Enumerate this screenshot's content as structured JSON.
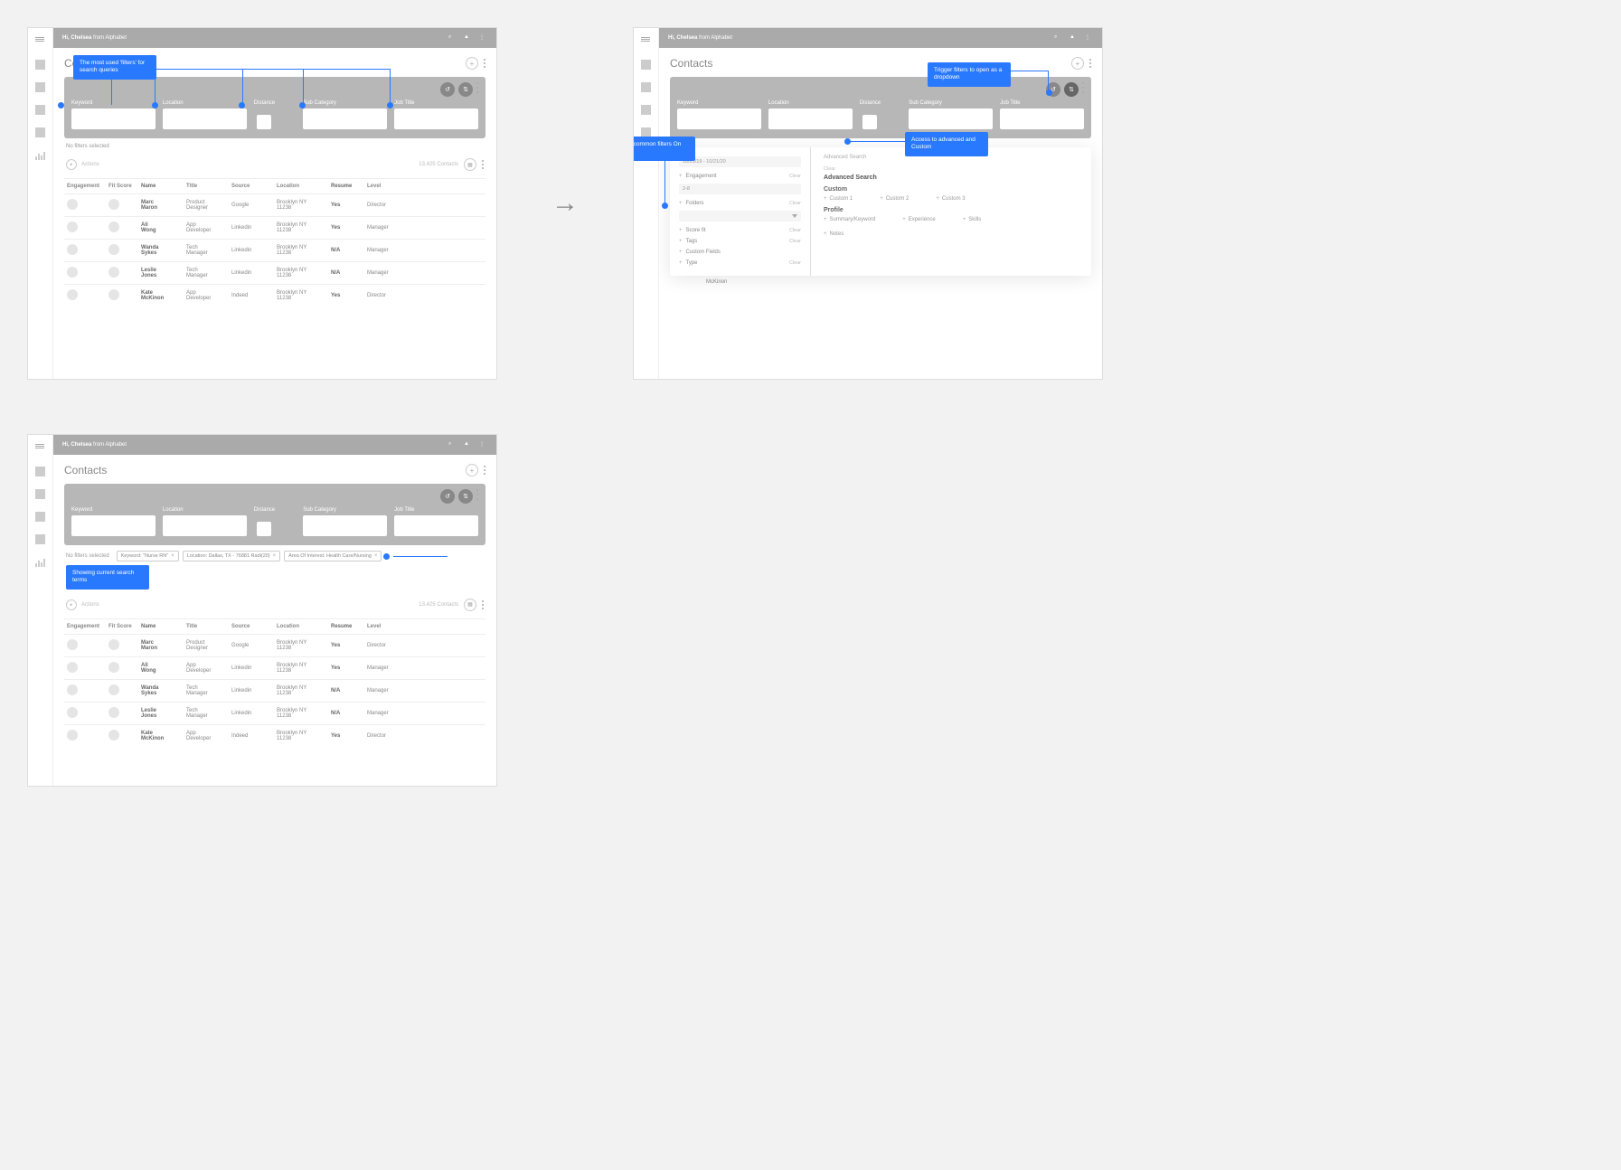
{
  "topbar": {
    "hi": "Hi, Chelsea",
    "from": "from Alphabet"
  },
  "page": {
    "title": "Contacts"
  },
  "filters": {
    "keyword": "Keyword",
    "location": "Location",
    "distance": "Distance",
    "subcat": "Sub Category",
    "jobtitle": "Job Title"
  },
  "noFilters": "No filters selected",
  "toolbar": {
    "actions": "Actions",
    "count": "13,425 Contacts"
  },
  "columns": [
    "Engagement",
    "Fit Score",
    "Name",
    "Title",
    "Source",
    "Location",
    "Resume",
    "Level"
  ],
  "rows": [
    {
      "name": "Marc Maron",
      "title": "Product Designer",
      "source": "Google",
      "loc": "Brooklyn NY 11238",
      "res": "Yes",
      "lvl": "Director"
    },
    {
      "name": "Ali Wong",
      "title": "App Developer",
      "source": "Linkedin",
      "loc": "Brooklyn NY 11238",
      "res": "Yes",
      "lvl": "Manager"
    },
    {
      "name": "Wanda Sykes",
      "title": "Tech Manager",
      "source": "Linkedin",
      "loc": "Brooklyn NY 11238",
      "res": "N/A",
      "lvl": "Manager"
    },
    {
      "name": "Leslie Jones",
      "title": "Tech Manager",
      "source": "Linkedin",
      "loc": "Brooklyn NY 11238",
      "res": "N/A",
      "lvl": "Manager"
    },
    {
      "name": "Kate McKinon",
      "title": "App Developer",
      "source": "Indeed",
      "loc": "Brooklyn NY 11238",
      "res": "Yes",
      "lvl": "Director"
    }
  ],
  "ann": {
    "s1": "The most used 'filters' for search queries",
    "s2a": "Trigger filters to open as a dropdown",
    "s2b": "More common filters On left",
    "s2c": "Access to advanced and Custom",
    "s3": "Showing current search terms"
  },
  "chips": {
    "c1": "Keyword: \"Nurse RN\"",
    "c2": "Location: Dallas, TX - 76881 Radi(20)",
    "c3": "Area Of Interest: Health Care/Nursing"
  },
  "dd": {
    "advsearch": "Advanced Search",
    "advsearchTitle": "Advanced Search",
    "clear": "Clear",
    "engagement": "Engagement",
    "engval": "2-8",
    "folders": "Folders",
    "scorefit": "Score fit",
    "tags": "Tags",
    "customfields": "Custom Fields",
    "type": "Type",
    "daterange": "10/21/19 - 10/21/20",
    "custom": "Custom",
    "custom1": "Custom 1",
    "custom2": "Custom 2",
    "custom3": "Custom 3",
    "profile": "Profile",
    "summary": "Summary/Keyword",
    "experience": "Experience",
    "skills": "Skills",
    "notes": "Notes"
  }
}
